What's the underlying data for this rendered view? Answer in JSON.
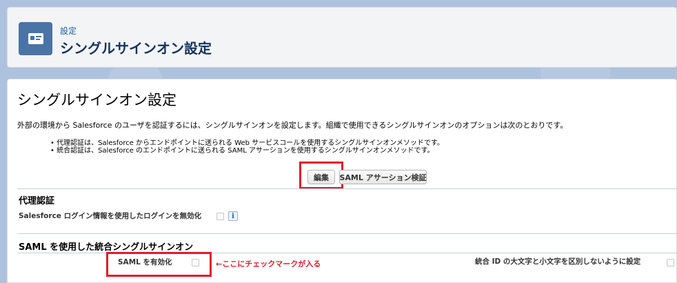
{
  "header": {
    "breadcrumb": "設定",
    "title": "シングルサインオン設定",
    "icon": "id-card-icon"
  },
  "main": {
    "title": "シングルサインオン設定",
    "description": "外部の環境から Salesforce のユーザを認証するには、シングルサインオンを設定します。組織で使用できるシングルサインオンのオプションは次のとおりです。",
    "bullets": [
      "• 代理認証は、Salesforce からエンドポイントに送られる Web サービスコールを使用するシングルサインオンメソッドです。",
      "• 統合認証は、Salesforce のエンドポイントに送られる SAML アサーションを使用するシングルサインオンメソッドです。"
    ],
    "buttons": {
      "edit": "編集",
      "saml_validate": "SAML アサーション検証"
    }
  },
  "delegated": {
    "section_title": "代理認証",
    "field_label": "Salesforce ログイン情報を使用したログインを無効化",
    "checked": false,
    "info_icon": "info-icon"
  },
  "saml": {
    "section_title": "SAML を使用した統合シングルサインオン",
    "enable_label": "SAML を有効化",
    "enable_checked": false,
    "annotation": "←ここにチェックマークが入る",
    "case_label": "統合 ID の大文字と小文字を区別しないように設定",
    "case_checked": false
  },
  "colors": {
    "accent": "#1a5ea8",
    "highlight_red": "#e11b2b",
    "header_icon_bg": "#4a73a6"
  }
}
